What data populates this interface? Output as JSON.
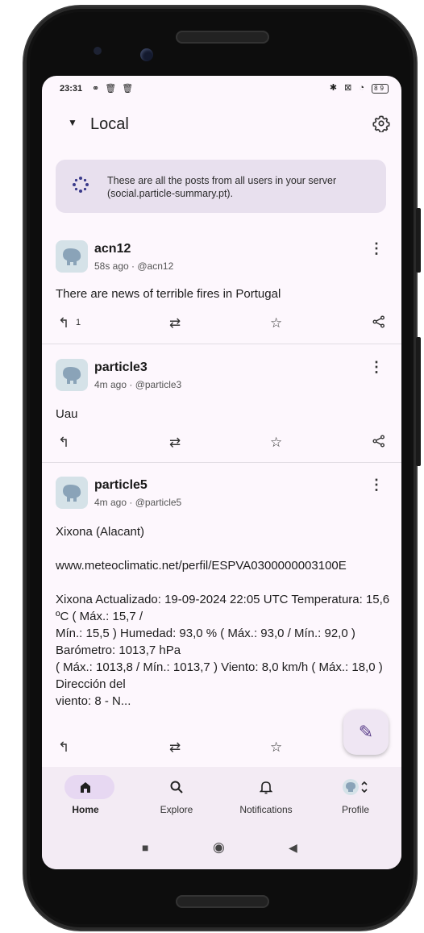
{
  "status": {
    "time": "23:31",
    "left_icons": "⚭ 🗑 🗑",
    "right_icons": "✱ ⊠ ◔",
    "battery": "89"
  },
  "appbar": {
    "dropdown_icon": "▼",
    "title": "Local",
    "settings_icon": "gear-icon"
  },
  "banner": {
    "icon": "timeline-icon",
    "text": "These are all the posts from all users in your server (social.particle-summary.pt)."
  },
  "posts": [
    {
      "name": "acn12",
      "meta": "58s ago · @acn12",
      "content": "There are news of terrible fires in Portugal",
      "reply_count": "1"
    },
    {
      "name": "particle3",
      "meta": "4m ago · @particle3",
      "content": "Uau",
      "reply_count": ""
    },
    {
      "name": "particle5",
      "meta": "4m ago · @particle5",
      "content_lines": [
        "Xixona (Alacant)",
        "",
        "www.meteoclimatic.net/perfil/ESPVA0300000003100E",
        "",
        "Xixona Actualizado: 19-09-2024 22:05 UTC Temperatura: 15,6 ºC ( Máx.: 15,7 /",
        "Mín.: 15,5 ) Humedad: 93,0 % ( Máx.: 93,0 / Mín.: 92,0 ) Barómetro: 1013,7 hPa",
        "( Máx.: 1013,8 / Mín.: 1013,7 ) Viento: 8,0 km/h ( Máx.: 18,0 ) Dirección del",
        "viento: 8 - N..."
      ],
      "reply_count": ""
    }
  ],
  "nav": {
    "home": "Home",
    "explore": "Explore",
    "notifications": "Notifications",
    "profile": "Profile"
  },
  "colors": {
    "screen_bg": "#fdf7fd",
    "banner_bg": "#e8e0ee",
    "nav_bg": "#f3ebf4",
    "active_pill": "#e7d8f2",
    "fab_bg": "#efe6f3"
  }
}
